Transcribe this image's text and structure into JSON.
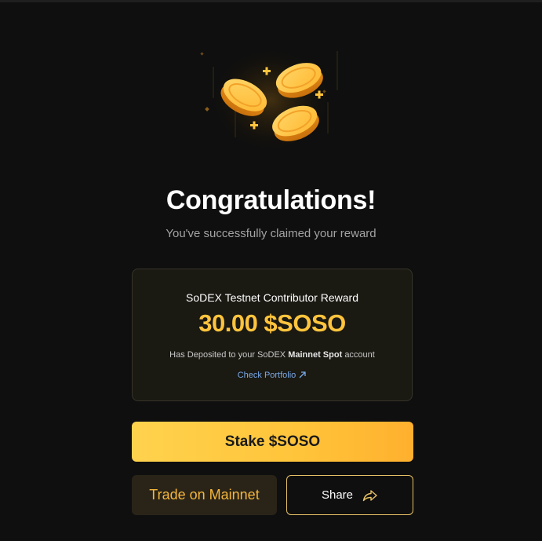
{
  "illustration": {
    "icon": "coins-icon"
  },
  "header": {
    "title": "Congratulations!",
    "subtitle": "You've successfully claimed your reward"
  },
  "reward": {
    "name": "SoDEX Testnet Contributor Reward",
    "amount": "30.00 $SOSO",
    "deposit_prefix": "Has Deposited to your SoDEX",
    "deposit_account": "Mainnet Spot",
    "deposit_suffix": "account",
    "link_label": "Check Portfolio"
  },
  "actions": {
    "stake_label": "Stake $SOSO",
    "trade_label": "Trade on Mainnet",
    "share_label": "Share"
  },
  "colors": {
    "background": "#0f0f0f",
    "accent": "#ffc43d",
    "link": "#7aa9e8",
    "card_border": "#37352a"
  }
}
